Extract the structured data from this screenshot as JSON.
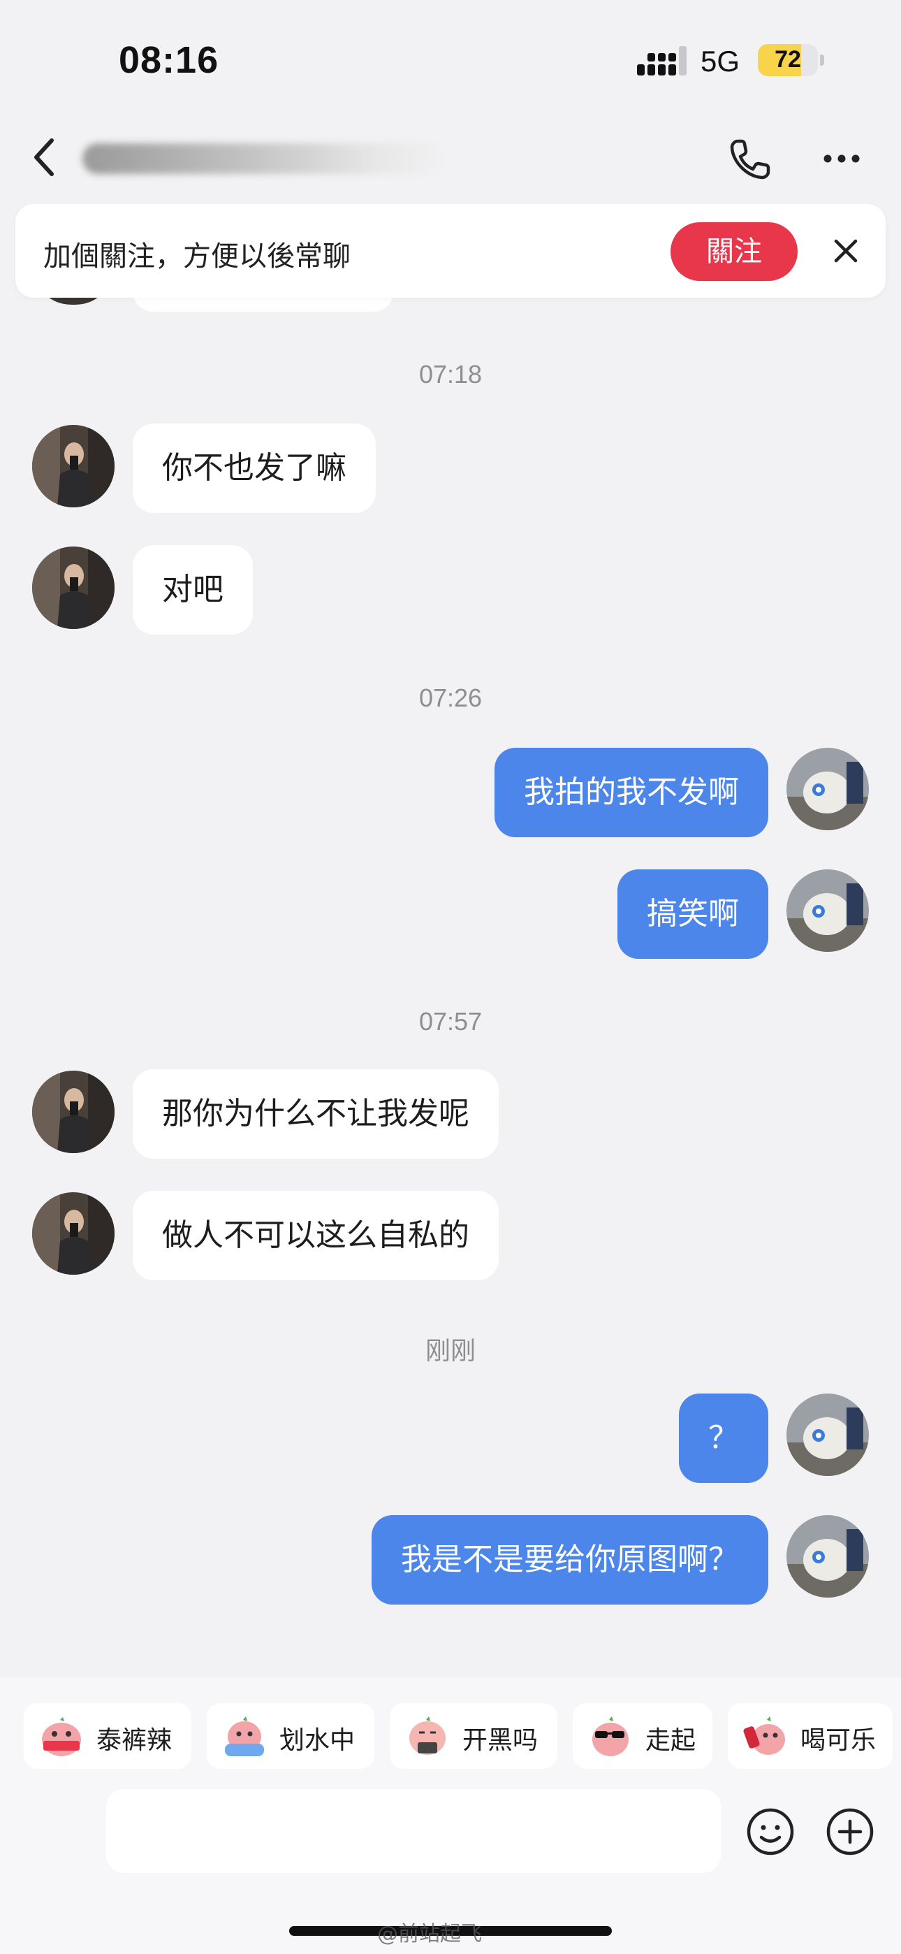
{
  "status_bar": {
    "time": "08:16",
    "network": "5G",
    "battery_level": "72",
    "battery_fraction": 0.72
  },
  "nav": {
    "back_icon": "chevron-left-icon",
    "call_icon": "phone-icon",
    "more_icon": "ellipsis-icon"
  },
  "follow_banner": {
    "text": "加個關注，方便以後常聊",
    "button_label": "關注",
    "button_color": "#e8364a"
  },
  "colors": {
    "outgoing_bubble": "#4c86ea",
    "incoming_bubble": "#ffffff",
    "background": "#f2f2f4"
  },
  "chat": {
    "timestamps": [
      "07:18",
      "07:26",
      "07:57",
      "刚刚"
    ],
    "messages": [
      {
        "direction": "in",
        "text": "你不也发了嘛"
      },
      {
        "direction": "in",
        "text": "对吧"
      },
      {
        "direction": "out",
        "text": "我拍的我不发啊"
      },
      {
        "direction": "out",
        "text": "搞笑啊"
      },
      {
        "direction": "in",
        "text": "那你为什么不让我发呢"
      },
      {
        "direction": "in",
        "text": "做人不可以这么自私的"
      },
      {
        "direction": "out",
        "text": "？"
      },
      {
        "direction": "out",
        "text": "我是不是要给你原图啊？"
      }
    ]
  },
  "stickers": [
    {
      "label": "泰裤辣",
      "icon": "sticker-cool-pink-icon"
    },
    {
      "label": "划水中",
      "icon": "sticker-swimming-icon"
    },
    {
      "label": "开黑吗",
      "icon": "sticker-gaming-icon"
    },
    {
      "label": "走起",
      "icon": "sticker-sunglasses-icon"
    },
    {
      "label": "喝可乐",
      "icon": "sticker-cola-icon"
    }
  ],
  "composer": {
    "placeholder": "",
    "emoji_icon": "smiley-icon",
    "plus_icon": "plus-circle-icon"
  },
  "watermark": "@前站起飞"
}
